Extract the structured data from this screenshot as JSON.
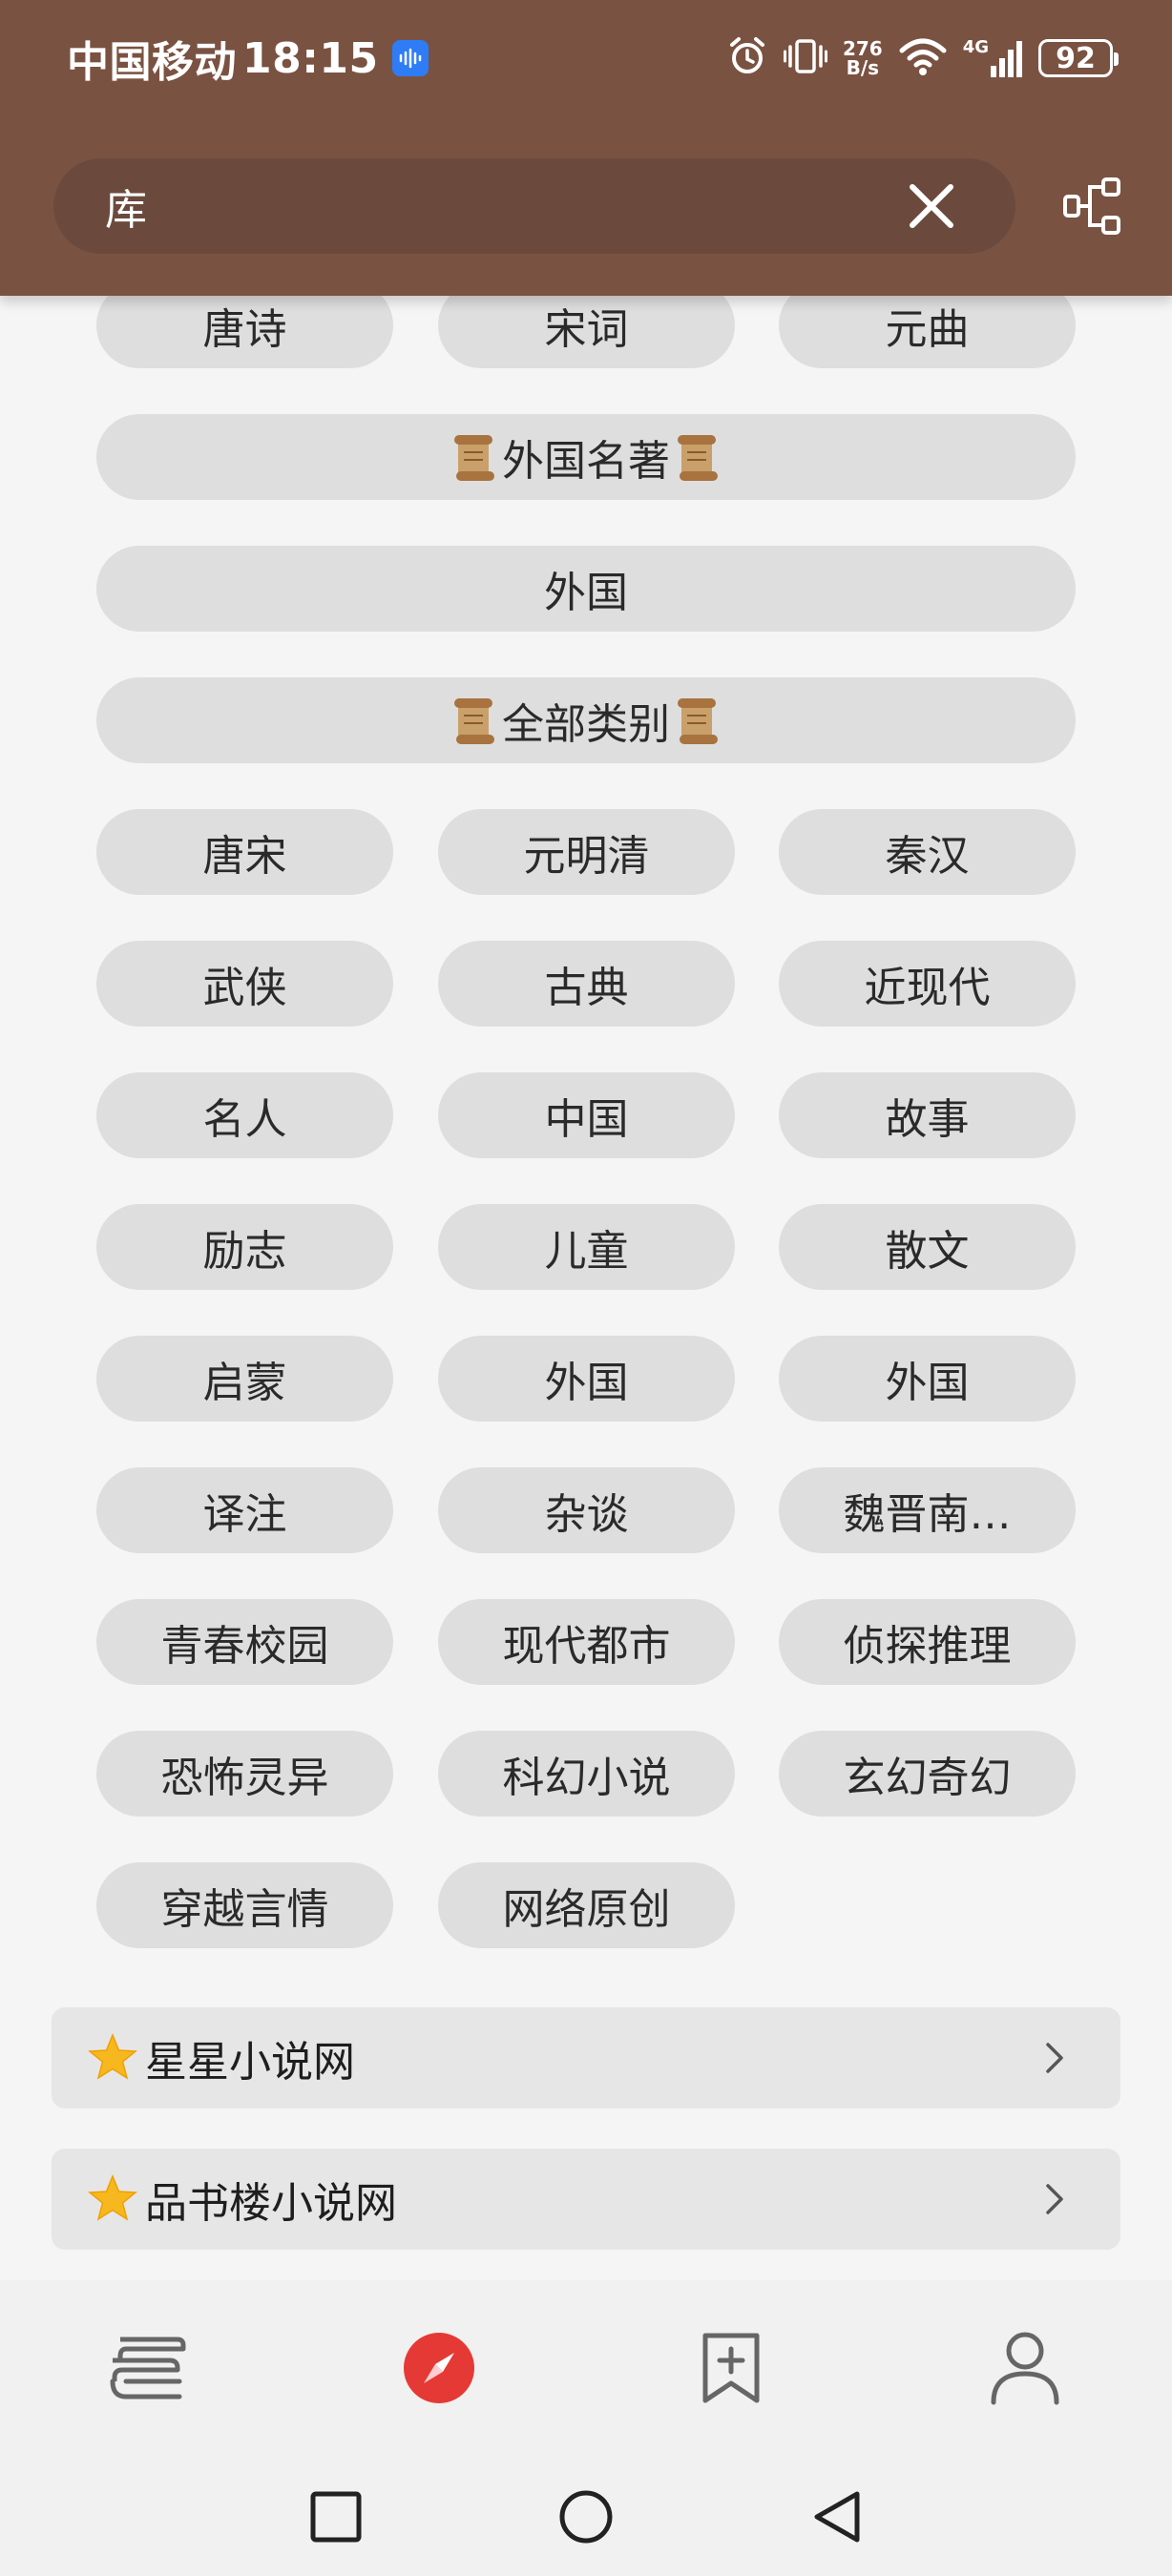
{
  "status_bar": {
    "carrier": "中国移动",
    "time": "18:15",
    "net_speed_value": "276",
    "net_speed_unit": "B/s",
    "network": "4G",
    "battery": "92"
  },
  "search": {
    "value": "库"
  },
  "top_row": [
    "唐诗",
    "宋词",
    "元曲"
  ],
  "sections": {
    "foreign_header": "外国名著",
    "foreign_item": "外国",
    "all_header": "全部类别"
  },
  "categories": [
    [
      "唐宋",
      "元明清",
      "秦汉"
    ],
    [
      "武侠",
      "古典",
      "近现代"
    ],
    [
      "名人",
      "中国",
      "故事"
    ],
    [
      "励志",
      "儿童",
      "散文"
    ],
    [
      "启蒙",
      "外国",
      "外国"
    ],
    [
      "译注",
      "杂谈",
      "魏晋南…"
    ],
    [
      "青春校园",
      "现代都市",
      "侦探推理"
    ],
    [
      "恐怖灵异",
      "科幻小说",
      "玄幻奇幻"
    ],
    [
      "穿越言情",
      "网络原创"
    ]
  ],
  "sites": [
    {
      "name": "星星小说网"
    },
    {
      "name": "品书楼小说网"
    }
  ],
  "colors": {
    "header": "#7a5242",
    "search_bg": "#6b4a3d",
    "pill_bg": "#dedede",
    "accent_red": "#e53935"
  }
}
